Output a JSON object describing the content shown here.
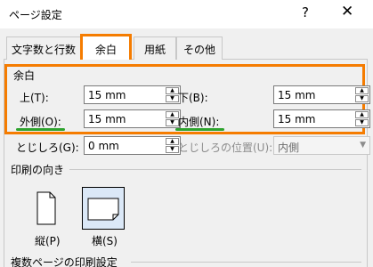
{
  "window": {
    "title": "ページ設定",
    "help": "?",
    "close": "✕"
  },
  "tabs": [
    "文字数と行数",
    "余白",
    "用紙",
    "その他"
  ],
  "margins": {
    "heading": "余白",
    "top_label": "上(T):",
    "top_value": "15 mm",
    "bottom_label": "下(B):",
    "bottom_value": "15 mm",
    "outer_label": "外側(O):",
    "outer_value": "15 mm",
    "inner_label": "内側(N):",
    "inner_value": "15 mm",
    "gutter_label": "とじしろ(G):",
    "gutter_value": "0 mm",
    "gutter_pos_label": "とじしろの位置(U):",
    "gutter_pos_value": "内側"
  },
  "orientation": {
    "heading": "印刷の向き",
    "portrait_label": "縦(P)",
    "landscape_label": "横(S)",
    "selected": "landscape"
  },
  "pages": {
    "heading": "複数ページの印刷設定"
  },
  "colors": {
    "highlight": "#f57c00",
    "underline": "#2ea32e"
  },
  "icons": [
    "help-icon",
    "close-icon",
    "spin-up-icon",
    "spin-down-icon",
    "dropdown-icon",
    "portrait-page-icon",
    "landscape-page-icon"
  ]
}
